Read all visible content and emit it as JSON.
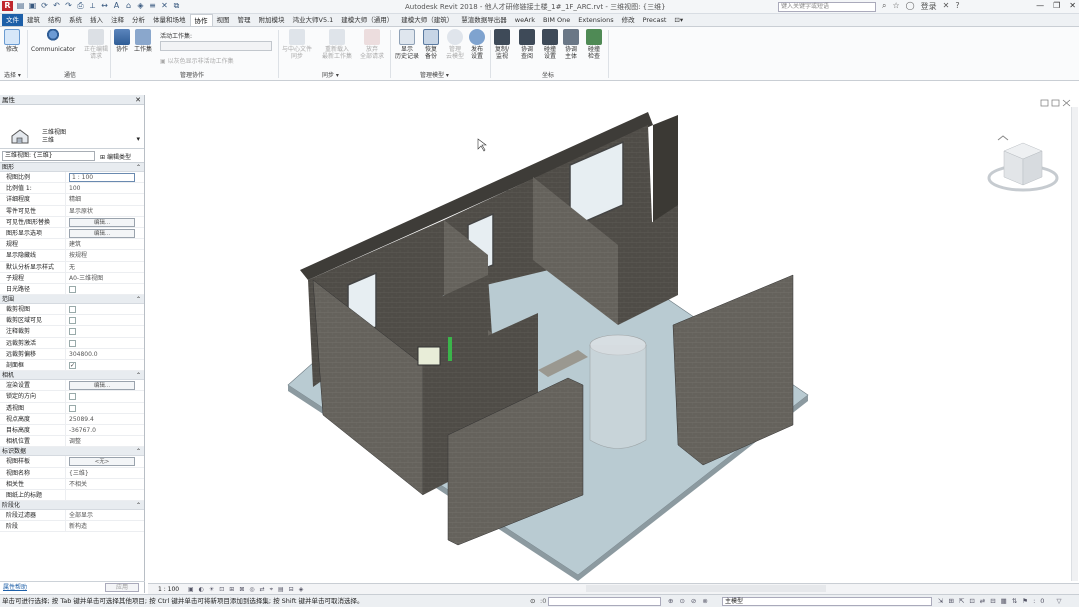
{
  "app": {
    "title": "Autodesk Revit 2018 -    他人才研修链接土楼_1#_1F_ARC.rvt - 三维视图: {三维}",
    "search_placeholder": "键入关键字或短语",
    "user": "登录"
  },
  "tabs": [
    "文件",
    "建筑",
    "结构",
    "系统",
    "插入",
    "注释",
    "分析",
    "体量和场地",
    "协作",
    "视图",
    "管理",
    "附加模块",
    "鸿业大师V5.1",
    "建模大师（通用）",
    "建模大师（建筑）",
    "慧渲数据导出器",
    "weArk",
    "BIM One",
    "Extensions",
    "修改",
    "Precast"
  ],
  "active_tab": "协作",
  "ribbon": {
    "modify": "修改",
    "select": "选择 ▾",
    "communicator": "Communicator",
    "comm_panel": "通信",
    "editing_requests": "正在编辑\n请求",
    "collaborate": "协作",
    "worksets": "工作集",
    "active_workset": "活动工作集:",
    "gray_hint": "以灰色显示非活动工作集",
    "manage_collab": "管理协作",
    "sync_central": "与中心文件\n同步",
    "reload_latest": "重新载入\n最新工作集",
    "relinquish_all": "放弃\n全部请求",
    "sync_panel": "同步 ▾",
    "show_history": "显示\n历史记录",
    "restore_backup": "恢复\n备份",
    "manage_cloud": "管理\n云模型",
    "publish_settings": "发布\n设置",
    "manage_models": "管理模型 ▾",
    "copy_monitor": "复制/\n监视",
    "coord_review": "协调\n查阅",
    "coord_settings": "碰撞\n设置",
    "coord_model": "协调\n主体",
    "interference": "碰撞\n检查",
    "coordinate": "坐标"
  },
  "properties": {
    "header": "属性",
    "type_name": "三维视图",
    "type_sub": "三维",
    "instance_selector": "三维视图: {三维}",
    "edit_type": "编辑类型",
    "sections": [
      {
        "name": "图形",
        "rows": [
          {
            "k": "视图比例",
            "v": "1 : 100",
            "t": "input"
          },
          {
            "k": "比例值 1:",
            "v": "100",
            "t": "text"
          },
          {
            "k": "详细程度",
            "v": "精细",
            "t": "text"
          },
          {
            "k": "零件可见性",
            "v": "显示原状",
            "t": "text"
          },
          {
            "k": "可见性/图形替换",
            "v": "编辑...",
            "t": "btn"
          },
          {
            "k": "图形显示选项",
            "v": "编辑...",
            "t": "btn"
          },
          {
            "k": "规程",
            "v": "建筑",
            "t": "text"
          },
          {
            "k": "显示隐藏线",
            "v": "按规程",
            "t": "text"
          },
          {
            "k": "默认分析显示样式",
            "v": "无",
            "t": "text"
          },
          {
            "k": "子规程",
            "v": "A0-三维视图",
            "t": "text"
          },
          {
            "k": "日光路径",
            "v": "",
            "t": "chk"
          }
        ]
      },
      {
        "name": "范围",
        "rows": [
          {
            "k": "裁剪视图",
            "v": "",
            "t": "chk"
          },
          {
            "k": "裁剪区域可见",
            "v": "",
            "t": "chk"
          },
          {
            "k": "注释裁剪",
            "v": "",
            "t": "chk"
          },
          {
            "k": "远裁剪激活",
            "v": "",
            "t": "chk"
          },
          {
            "k": "远裁剪偏移",
            "v": "304800.0",
            "t": "text"
          },
          {
            "k": "剖面框",
            "v": "on",
            "t": "chk"
          }
        ]
      },
      {
        "name": "相机",
        "rows": [
          {
            "k": "渲染设置",
            "v": "编辑...",
            "t": "btn"
          },
          {
            "k": "锁定的方向",
            "v": "",
            "t": "chk"
          },
          {
            "k": "透视图",
            "v": "",
            "t": "chk"
          },
          {
            "k": "视点高度",
            "v": "25089.4",
            "t": "text"
          },
          {
            "k": "目标高度",
            "v": "-36767.0",
            "t": "text"
          },
          {
            "k": "相机位置",
            "v": "调整",
            "t": "text"
          }
        ]
      },
      {
        "name": "标识数据",
        "rows": [
          {
            "k": "视图样板",
            "v": "<无>",
            "t": "btn"
          },
          {
            "k": "视图名称",
            "v": "{三维}",
            "t": "text"
          },
          {
            "k": "相关性",
            "v": "不相关",
            "t": "text"
          },
          {
            "k": "图纸上的标题",
            "v": "",
            "t": "text"
          }
        ]
      },
      {
        "name": "阶段化",
        "rows": [
          {
            "k": "阶段过滤器",
            "v": "全部显示",
            "t": "text"
          },
          {
            "k": "阶段",
            "v": "新构造",
            "t": "text"
          }
        ]
      }
    ],
    "help": "属性帮助",
    "apply": "应用"
  },
  "view_control": {
    "scale": "1 : 100"
  },
  "status": {
    "text": "单击可进行选择; 按 Tab 键并单击可选择其他项目; 按 Ctrl 键并单击可将新项目添加到选择集; 按 Shift 键并单击可取消选择。",
    "model": "主模型",
    "zero": ":0"
  }
}
